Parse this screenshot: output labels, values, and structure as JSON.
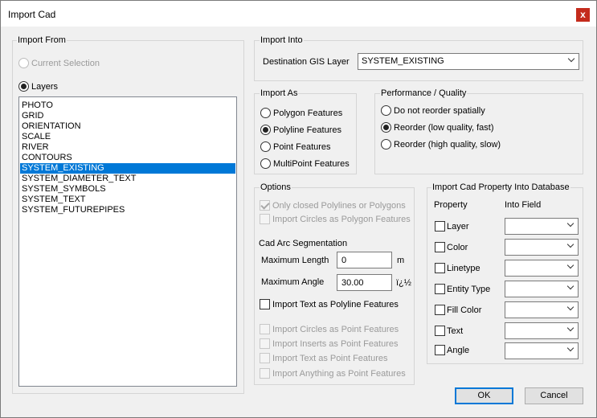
{
  "window": {
    "title": "Import Cad",
    "close_glyph": "x"
  },
  "import_from": {
    "label": "Import From",
    "current_selection": "Current Selection",
    "layers": "Layers",
    "layer_items": [
      "PHOTO",
      "GRID",
      "ORIENTATION",
      "SCALE",
      "RIVER",
      "CONTOURS",
      "SYSTEM_EXISTING",
      "SYSTEM_DIAMETER_TEXT",
      "SYSTEM_SYMBOLS",
      "SYSTEM_TEXT",
      "SYSTEM_FUTUREPIPES"
    ],
    "selected_layer": "SYSTEM_EXISTING"
  },
  "import_into": {
    "label": "Import Into",
    "dest_label": "Destination GIS Layer",
    "dest_value": "SYSTEM_EXISTING"
  },
  "import_as": {
    "label": "Import As",
    "polygon": "Polygon Features",
    "polyline": "Polyline Features",
    "point": "Point Features",
    "multipoint": "MultiPoint Features",
    "selected": "Polyline Features"
  },
  "performance": {
    "label": "Performance / Quality",
    "no_reorder": "Do not reorder spatially",
    "reorder_low": "Reorder (low quality, fast)",
    "reorder_high": "Reorder (high quality, slow)",
    "selected": "Reorder (low quality, fast)"
  },
  "options": {
    "label": "Options",
    "only_closed": "Only closed Polylines or Polygons",
    "circles_polygon": "Import Circles as Polygon Features",
    "arc_seg": "Cad Arc Segmentation",
    "max_length_label": "Maximum Length",
    "max_length_value": "0",
    "max_length_unit": "m",
    "max_angle_label": "Maximum Angle",
    "max_angle_value": "30.00",
    "max_angle_unit": "ï¿½",
    "text_polyline": "Import Text as Polyline Features",
    "circles_point": "Import Circles as Point Features",
    "inserts_point": "Import Inserts as Point Features",
    "text_point": "Import Text as Point Features",
    "anything_point": "Import Anything as Point Features"
  },
  "cad_property": {
    "label": "Import Cad Property Into Database",
    "property_header": "Property",
    "into_field_header": "Into Field",
    "layer": "Layer",
    "color": "Color",
    "linetype": "Linetype",
    "entity_type": "Entity Type",
    "fill_color": "Fill Color",
    "text": "Text",
    "angle": "Angle"
  },
  "buttons": {
    "ok": "OK",
    "cancel": "Cancel"
  },
  "colors": {
    "selection": "#0078d7",
    "close": "#c42b1c"
  }
}
